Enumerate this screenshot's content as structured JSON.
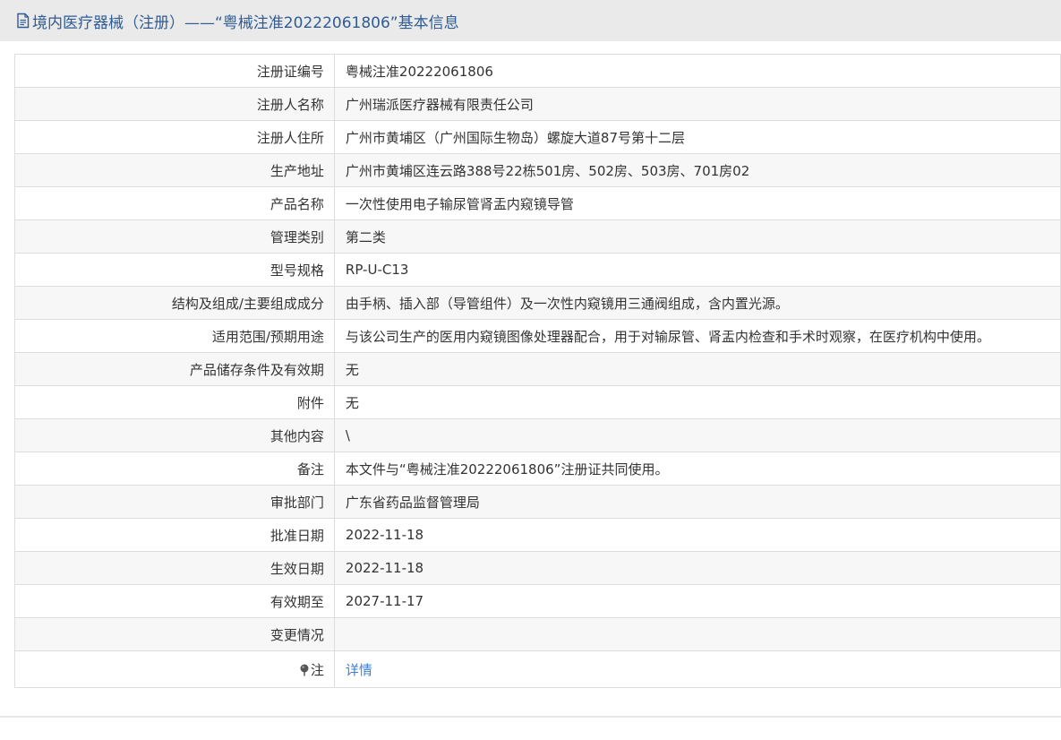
{
  "header": {
    "icon": "document-icon",
    "title": "境内医疗器械（注册）——“粤械注准20222061806”基本信息"
  },
  "fields": [
    {
      "key": "reg_no",
      "label": "注册证编号",
      "value": "粤械注准20222061806"
    },
    {
      "key": "registrant_name",
      "label": "注册人名称",
      "value": "广州瑞派医疗器械有限责任公司"
    },
    {
      "key": "registrant_address",
      "label": "注册人住所",
      "value": "广州市黄埔区（广州国际生物岛）螺旋大道87号第十二层"
    },
    {
      "key": "production_address",
      "label": "生产地址",
      "value": "广州市黄埔区连云路388号22栋501房、502房、503房、701房02"
    },
    {
      "key": "product_name",
      "label": "产品名称",
      "value": "一次性使用电子输尿管肾盂内窥镜导管"
    },
    {
      "key": "management_class",
      "label": "管理类别",
      "value": "第二类"
    },
    {
      "key": "model_spec",
      "label": "型号规格",
      "value": "RP-U-C13"
    },
    {
      "key": "structure",
      "label": "结构及组成/主要组成成分",
      "value": "由手柄、插入部（导管组件）及一次性内窥镜用三通阀组成，含内置光源。"
    },
    {
      "key": "intended_use",
      "label": "适用范围/预期用途",
      "value": "与该公司生产的医用内窥镜图像处理器配合，用于对输尿管、肾盂内检查和手术时观察，在医疗机构中使用。"
    },
    {
      "key": "storage",
      "label": "产品储存条件及有效期",
      "value": "无"
    },
    {
      "key": "attachment",
      "label": "附件",
      "value": "无"
    },
    {
      "key": "other",
      "label": "其他内容",
      "value": "\\"
    },
    {
      "key": "remark",
      "label": "备注",
      "value": "本文件与“粤械注准20222061806”注册证共同使用。"
    },
    {
      "key": "approval_dept",
      "label": "审批部门",
      "value": "广东省药品监督管理局"
    },
    {
      "key": "approval_date",
      "label": "批准日期",
      "value": "2022-11-18"
    },
    {
      "key": "effective_date",
      "label": "生效日期",
      "value": "2022-11-18"
    },
    {
      "key": "expiry_date",
      "label": "有效期至",
      "value": "2027-11-17"
    },
    {
      "key": "changes",
      "label": "变更情况",
      "value": ""
    }
  ],
  "note": {
    "icon": "pin-icon",
    "label": "注",
    "link_text": "详情"
  },
  "colors": {
    "header_bg": "#eaeaea",
    "header_text": "#2f5c94",
    "link": "#3a7fd5",
    "border": "#dddddd",
    "stripe": "#f7f7f7"
  }
}
